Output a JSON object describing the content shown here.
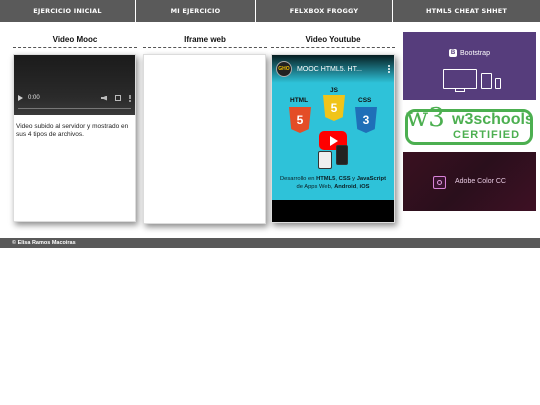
{
  "nav": {
    "items": [
      "EJERCICIO INICIAL",
      "MI EJERCICIO",
      "FELXBOX FROGGY",
      "HTML5 CHEAT SHHET"
    ]
  },
  "columns": {
    "mooc": {
      "title": "Video Mooc",
      "video_time": "0:00",
      "description": "Video subido al servidor y mostrado en sus 4 tipos de archivos."
    },
    "iframe": {
      "title": "Iframe web"
    },
    "youtube": {
      "title": "Video Youtube",
      "video_title": "MOOC HTML5. HT...",
      "channel_badge": "GHO",
      "badges": [
        "HTML",
        "JS",
        "CSS"
      ],
      "shield_numbers": [
        "5",
        "5",
        "3"
      ],
      "desc_part1": "Desarrollo en ",
      "desc_html": "HTML5",
      "desc_sep1": ", ",
      "desc_css": "CSS",
      "desc_sep2": " y ",
      "desc_js": "JavaScript",
      "desc_part2": "de Apps Web, ",
      "desc_android": "Android",
      "desc_sep3": ", ",
      "desc_ios": "iOS"
    }
  },
  "ads": {
    "bootstrap_label": "Bootstrap",
    "bootstrap_icon_letter": "B",
    "w3_logo_text": "w3schools",
    "w3_certified": "CERTIFIED",
    "w3_brand_prefix": "w",
    "w3_brand_number": "3",
    "adobe_label": "Adobe Color CC"
  },
  "footer": {
    "text": "© Elisa Ramos Macoiras"
  },
  "colors": {
    "nav_bg": "#595959",
    "bootstrap_purple": "#563d7c",
    "w3_green": "#4caf50",
    "youtube_red": "#ff0000",
    "youtube_bg": "#2ec2d9"
  }
}
